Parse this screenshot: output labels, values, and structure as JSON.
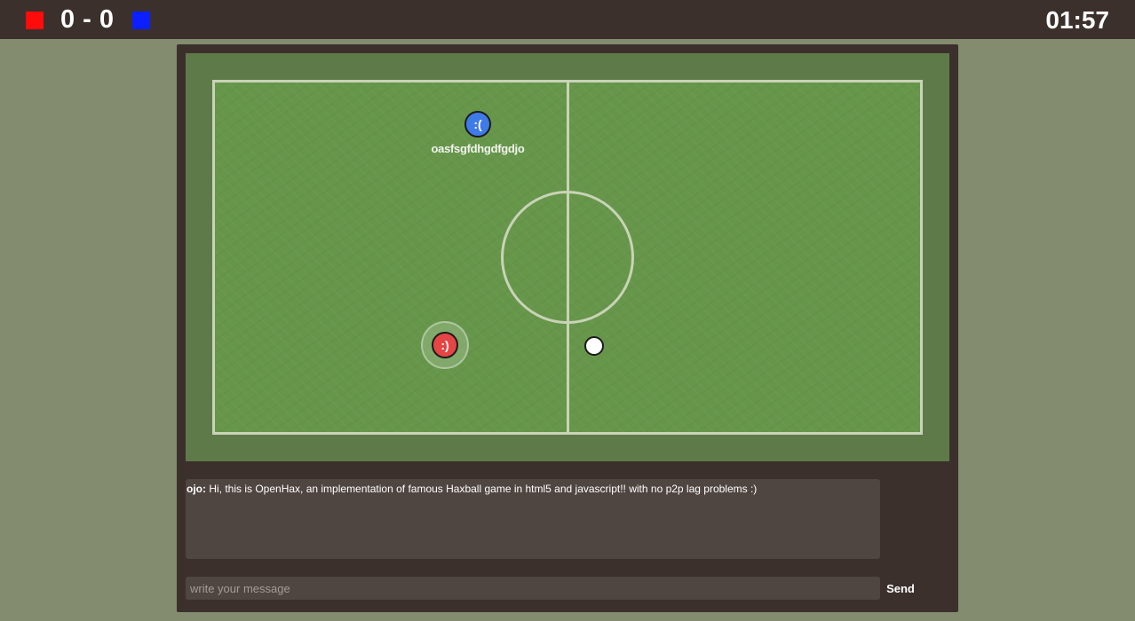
{
  "scoreboard": {
    "score": "0 - 0",
    "timer": "01:57",
    "red_team_color": "#ff0b0b",
    "blue_team_color": "#0b1fff"
  },
  "field": {
    "players": [
      {
        "team": "blue",
        "avatar": ":(",
        "name": "oasfsgfdhgdfgdjo",
        "color": "#3f7be8"
      },
      {
        "team": "red",
        "avatar": ":)",
        "name": "",
        "color": "#e64545"
      }
    ]
  },
  "chat": {
    "messages": [
      {
        "sender": "ojo:",
        "text": " Hi, this is OpenHax, an implementation of famous Haxball game in html5 and javascript!! with no p2p lag problems :)"
      }
    ],
    "input_placeholder": "write your message",
    "send_label": "Send"
  }
}
